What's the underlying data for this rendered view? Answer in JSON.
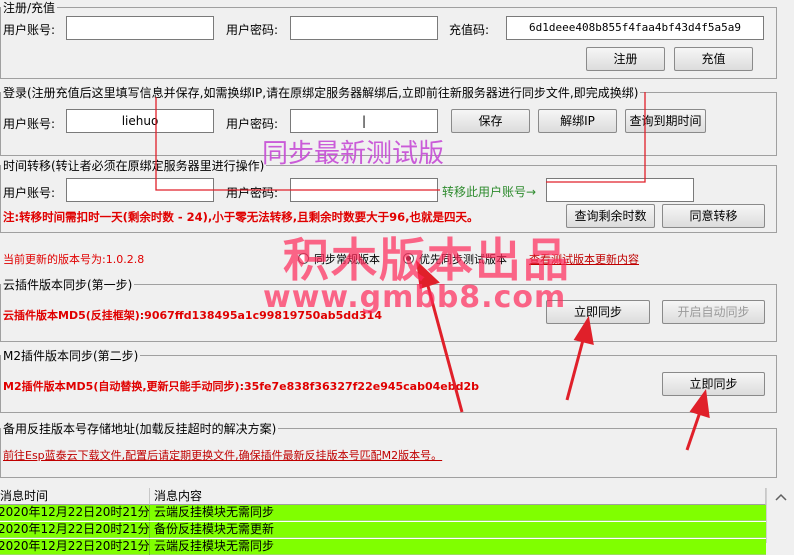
{
  "register": {
    "legend": "注册/充值",
    "account_label": "用户账号:",
    "account_value": "",
    "password_label": "用户密码:",
    "password_value": "",
    "code_label": "充值码:",
    "code_value": "6d1deee408b855f4faa4bf43d4f5a5a9",
    "register_button": "注册",
    "recharge_button": "充值"
  },
  "login": {
    "legend": "登录(注册充值后这里填写信息并保存,如需换绑IP,请在原绑定服务器解绑后,立即前往新服务器进行同步文件,即完成换绑)",
    "account_label": "用户账号:",
    "account_value": "liehuo",
    "password_label": "用户密码:",
    "password_value": "|",
    "save_button": "保存",
    "unbind_button": "解绑IP",
    "query_expire_button": "查询到期时间"
  },
  "transfer": {
    "legend": "时间转移(转让者必须在原绑定服务器里进行操作)",
    "account_label": "用户账号:",
    "account_value": "",
    "password_label": "用户密码:",
    "password_value": "",
    "target_label": "转移此用户账号→",
    "target_value": "",
    "notice": "注:转移时间需扣时一天(剩余时数 - 24),小于零无法转移,且剩余时数要大于96,也就是四天。",
    "query_remaining_button": "查询剩余时数",
    "agree_button": "同意转移"
  },
  "version": {
    "current_label": "当前更新的版本号为:1.0.2.8",
    "radio_normal": "同步常规版本",
    "radio_test": "优先同步测试版本",
    "view_test_link": "查看测试版本更新内容",
    "selected": "test"
  },
  "cloud_sync": {
    "legend": "云插件版本同步(第一步)",
    "md5_text": "云插件版本MD5(反挂框架):9067ffd138495a1c99819750ab5dd314",
    "sync_button": "立即同步",
    "auto_sync_button": "开启自动同步"
  },
  "m2_sync": {
    "legend": "M2插件版本同步(第二步)",
    "md5_text": "M2插件版本MD5(自动替换,更新只能手动同步):35fe7e838f36327f22e945cab04ebd2b",
    "sync_button": "立即同步"
  },
  "backup": {
    "legend": "备用反挂版本号存储地址(加载反挂超时的解决方案)",
    "link": "前往Esp蓝泰云下载文件,配置后请定期更换文件,确保插件最新反挂版本号匹配M2版本号。"
  },
  "log": {
    "col_time": "消息时间",
    "col_content": "消息内容",
    "rows": [
      {
        "time": "2020年12月22日20时21分...",
        "content": "云端反挂模块无需同步"
      },
      {
        "time": "2020年12月22日20时21分...",
        "content": "备份反挂模块无需更新"
      },
      {
        "time": "2020年12月22日20时21分...",
        "content": "云端反挂模块无需同步"
      }
    ]
  },
  "overlay": {
    "test_version_title": "同步最新测试版",
    "watermark_brand": "积木版本出品",
    "watermark_url": "www.gmbb8.com"
  },
  "colors": {
    "red_text": "#e00000",
    "log_row_green": "#80ff00",
    "annotation_red": "#e0202a",
    "watermark_purple": "#c64bd6",
    "transfer_green": "#2e8b2e"
  }
}
